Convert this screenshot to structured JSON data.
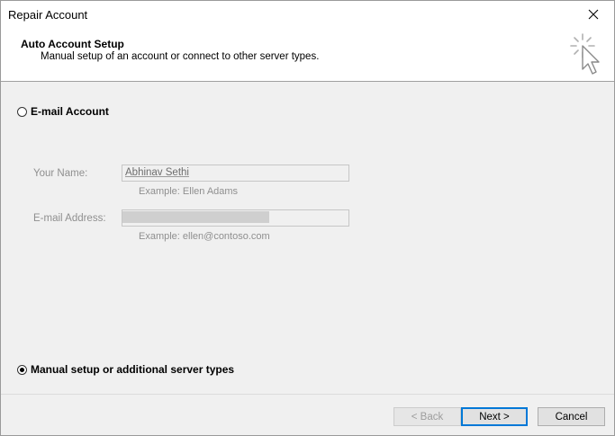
{
  "window": {
    "title": "Repair Account",
    "close_icon": "close-icon"
  },
  "header": {
    "title": "Auto Account Setup",
    "subtitle": "Manual setup of an account or connect to other server types.",
    "icon": "wizard-cursor-icon"
  },
  "options": {
    "email_account": {
      "label": "E-mail Account",
      "selected": false
    },
    "manual_setup": {
      "label": "Manual setup or additional server types",
      "selected": true
    }
  },
  "form": {
    "your_name": {
      "label": "Your Name:",
      "value": "Abhinav Sethi",
      "example": "Example: Ellen Adams"
    },
    "email_address": {
      "label": "E-mail Address:",
      "value": "",
      "example": "Example: ellen@contoso.com"
    }
  },
  "buttons": {
    "back": "< Back",
    "next": "Next >",
    "cancel": "Cancel"
  },
  "colors": {
    "accent": "#0078d7",
    "disabled_text": "#8f8f8f"
  }
}
